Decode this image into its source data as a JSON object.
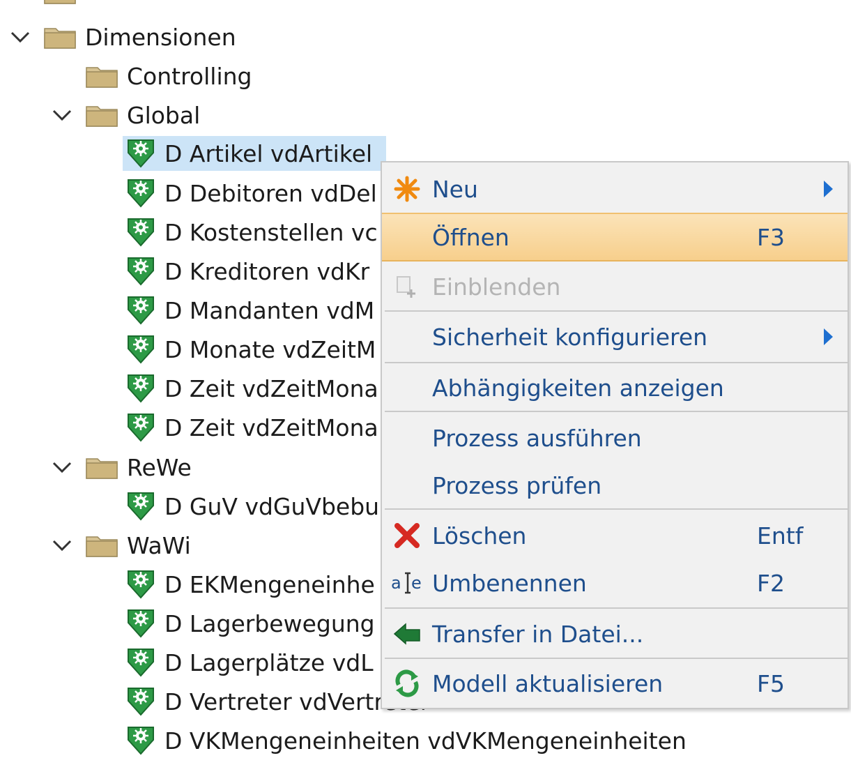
{
  "tree": {
    "dimensionen": "Dimensionen",
    "controlling": "Controlling",
    "global": "Global",
    "global_items": [
      "D Artikel vdArtikel",
      "D Debitoren vdDel",
      "D Kostenstellen vc",
      "D Kreditoren vdKr",
      "D Mandanten vdM",
      "D Monate vdZeitM",
      "D Zeit vdZeitMona",
      "D Zeit vdZeitMona"
    ],
    "rewe": "ReWe",
    "rewe_items": [
      "D GuV vdGuVbebu"
    ],
    "wawi": "WaWi",
    "wawi_items": [
      "D EKMengeneinhe",
      "D Lagerbewegung",
      "D Lagerplätze vdL",
      "D Vertreter vdVertreter",
      "D VKMengeneinheiten vdVKMengeneinheiten"
    ]
  },
  "context_menu": {
    "neu": "Neu",
    "oeffnen": "Öffnen",
    "oeffnen_shortcut": "F3",
    "einblenden": "Einblenden",
    "sicherheit": "Sicherheit konfigurieren",
    "abhaengigkeiten": "Abhängigkeiten anzeigen",
    "prozess_ausfuehren": "Prozess ausführen",
    "prozess_pruefen": "Prozess prüfen",
    "loeschen": "Löschen",
    "loeschen_shortcut": "Entf",
    "umbenennen": "Umbenennen",
    "umbenennen_shortcut": "F2",
    "transfer": "Transfer in Datei...",
    "modell": "Modell aktualisieren",
    "modell_shortcut": "F5"
  },
  "colors": {
    "menu_text": "#1e4e8c",
    "hover": "#f7cf8c",
    "selection": "#cce4f7",
    "folder": "#c8b27a",
    "dim_icon": "#1f8a3c"
  }
}
